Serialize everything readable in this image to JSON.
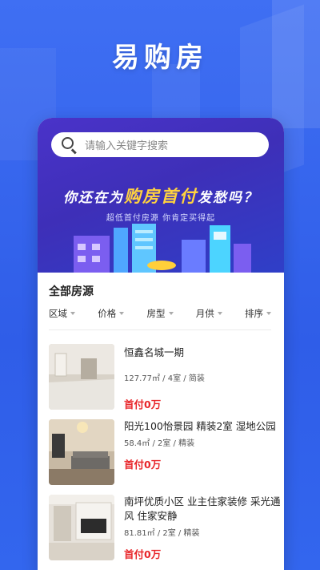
{
  "app": {
    "title": "易购房"
  },
  "search": {
    "placeholder": "请输入关键字搜索"
  },
  "banner": {
    "slogan_pre": "你还在为",
    "slogan_highlight": "购房首付",
    "slogan_post": "发愁吗？",
    "subslogan": "超低首付房源 你肯定买得起"
  },
  "section": {
    "title": "全部房源"
  },
  "filters": [
    {
      "label": "区域"
    },
    {
      "label": "价格"
    },
    {
      "label": "房型"
    },
    {
      "label": "月供"
    },
    {
      "label": "排序"
    }
  ],
  "listings": [
    {
      "name": "恒鑫名城一期",
      "area": "127.77㎡",
      "rooms": "4室",
      "decor": "简装",
      "price": "首付0万"
    },
    {
      "name": "阳光100怡景园 精装2室 湿地公园",
      "area": "58.4㎡",
      "rooms": "2室",
      "decor": "精装",
      "price": "首付0万"
    },
    {
      "name": "南坪优质小区 业主住家装修 采光通风 住家安静",
      "area": "81.81㎡",
      "rooms": "2室",
      "decor": "精装",
      "price": "首付0万"
    }
  ],
  "colors": {
    "brand_blue": "#3f6ff3",
    "banner_purple": "#4a33c9",
    "price_red": "#e8262a",
    "highlight_yellow": "#ffd23f"
  }
}
